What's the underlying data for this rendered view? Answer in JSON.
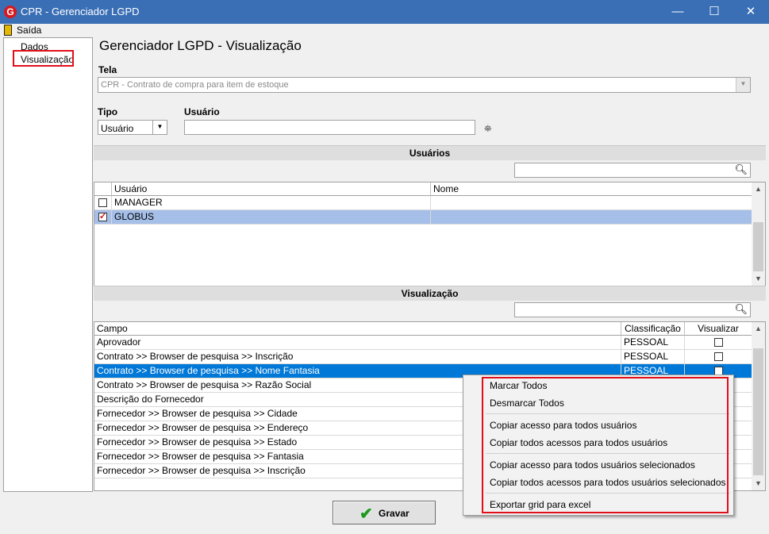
{
  "window": {
    "title": "CPR - Gerenciador LGPD",
    "logo": "G",
    "minimize": "—",
    "maximize": "☐",
    "close": "✕"
  },
  "menu": {
    "exit_label": "Saída"
  },
  "tree": {
    "items": [
      "Dados",
      "Visualização"
    ],
    "selected": "Visualização"
  },
  "page": {
    "title": "Gerenciador LGPD - Visualização"
  },
  "tela": {
    "label": "Tela",
    "value": "CPR - Contrato de compra para item de estoque"
  },
  "tipo": {
    "label": "Tipo",
    "value": "Usuário"
  },
  "usuario": {
    "label": "Usuário",
    "value": ""
  },
  "users_section": {
    "title": "Usuários",
    "columns": [
      "Usuário",
      "Nome"
    ],
    "rows": [
      {
        "user": "MANAGER",
        "name": "",
        "checked": false
      },
      {
        "user": "GLOBUS",
        "name": "",
        "checked": true
      }
    ]
  },
  "view_section": {
    "title": "Visualização",
    "columns": [
      "Campo",
      "Classificação",
      "Visualizar"
    ],
    "rows": [
      {
        "campo": "Aprovador",
        "class": "PESSOAL"
      },
      {
        "campo": "Contrato >> Browser de pesquisa >> Inscrição",
        "class": "PESSOAL"
      },
      {
        "campo": "Contrato >> Browser de pesquisa >> Nome Fantasia",
        "class": "PESSOAL"
      },
      {
        "campo": "Contrato >> Browser de pesquisa >> Razão Social",
        "class": ""
      },
      {
        "campo": "Descrição do Fornecedor",
        "class": ""
      },
      {
        "campo": "Fornecedor >> Browser de pesquisa >> Cidade",
        "class": ""
      },
      {
        "campo": "Fornecedor >> Browser de pesquisa >> Endereço",
        "class": ""
      },
      {
        "campo": "Fornecedor >> Browser de pesquisa >> Estado",
        "class": ""
      },
      {
        "campo": "Fornecedor >> Browser de pesquisa >> Fantasia",
        "class": ""
      },
      {
        "campo": "Fornecedor >> Browser de pesquisa >> Inscrição",
        "class": ""
      }
    ]
  },
  "context_menu": {
    "items": [
      "Marcar Todos",
      "Desmarcar Todos",
      "Copiar acesso para todos usuários",
      "Copiar todos acessos para todos usuários",
      "Copiar acesso para todos usuários selecionados",
      "Copiar todos acessos para todos usuários selecionados",
      "Exportar grid para excel"
    ]
  },
  "save_button": {
    "label": "Gravar"
  },
  "colors": {
    "selection_blue": "#0078d7",
    "selection_light": "#a5bfe9",
    "highlight_red": "#e0101a",
    "titlebar": "#3a6fb5"
  }
}
